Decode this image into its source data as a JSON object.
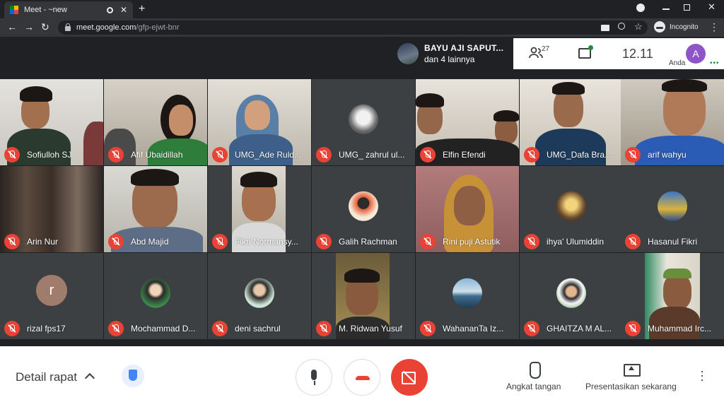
{
  "browser": {
    "tab_title": "Meet - ~new",
    "url_host": "meet.google.com",
    "url_path": "/gfp-ejwt-bnr",
    "profile_label": "Incognito",
    "new_tab_label": "+",
    "close_tab_label": "✕"
  },
  "meet": {
    "presenter": {
      "line1": "BAYU AJI SAPUT...",
      "line2": "dan 4 lainnya"
    },
    "people_count": "27",
    "time": "12.11",
    "user_initial": "A",
    "you_label": "Anda"
  },
  "participants": [
    {
      "name": "Sofiulloh SJ"
    },
    {
      "name": "Afif Ubaidillah"
    },
    {
      "name": "UMG_Ade Ruld..."
    },
    {
      "name": "UMG_ zahrul ul..."
    },
    {
      "name": "Elfin Efendi"
    },
    {
      "name": "UMG_Dafa Bra..."
    },
    {
      "name": "arif wahyu"
    },
    {
      "name": "Arin Nur"
    },
    {
      "name": "Abd Majid"
    },
    {
      "name": "Fikri Normansy..."
    },
    {
      "name": "Galih Rachman"
    },
    {
      "name": "Rini puji Astutik"
    },
    {
      "name": "ihya' Ulumiddin"
    },
    {
      "name": "Hasanul Fikri"
    },
    {
      "name": "rizal fps17",
      "initial": "r"
    },
    {
      "name": "Mochammad D..."
    },
    {
      "name": "deni sachrul"
    },
    {
      "name": "M. Ridwan Yusuf"
    },
    {
      "name": "WahananTa Iz..."
    },
    {
      "name": "GHAITZA M AL..."
    },
    {
      "name": "Muhammad Irc..."
    }
  ],
  "bottom": {
    "details_label": "Detail rapat",
    "raise_hand_label": "Angkat tangan",
    "present_label": "Presentasikan sekarang"
  },
  "colors": {
    "accent_red": "#ea4335",
    "meet_dark": "#202124",
    "tile_bg": "#3c4043",
    "avatar_purple": "#8e55c8"
  }
}
